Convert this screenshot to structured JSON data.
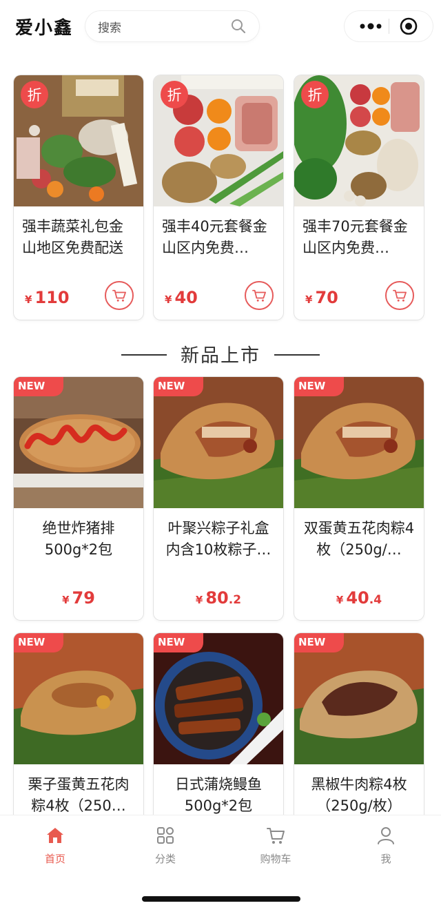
{
  "header": {
    "app_title": "爱小鑫",
    "search_placeholder": "搜索"
  },
  "promo": {
    "badge": "折",
    "products": [
      {
        "name": "强丰蔬菜礼包金山地区免费配送",
        "currency": "¥",
        "price_int": "110",
        "price_dec": ""
      },
      {
        "name": "强丰40元套餐金山区内免费…",
        "currency": "¥",
        "price_int": "40",
        "price_dec": ""
      },
      {
        "name": "强丰70元套餐金山区内免费…",
        "currency": "¥",
        "price_int": "70",
        "price_dec": ""
      }
    ]
  },
  "new_section": {
    "title": "新品上市",
    "badge": "NEW",
    "products": [
      {
        "name": "绝世炸猪排500g*2包",
        "currency": "¥",
        "price_int": "79",
        "price_dec": ""
      },
      {
        "name": "叶聚兴粽子礼盒内含10枚粽子…",
        "currency": "¥",
        "price_int": "80",
        "price_dec": ".2"
      },
      {
        "name": "双蛋黄五花肉粽4枚（250g/…",
        "currency": "¥",
        "price_int": "40",
        "price_dec": ".4"
      },
      {
        "name": "栗子蛋黄五花肉粽4枚（250…",
        "currency": "¥",
        "price_int": "",
        "price_dec": ""
      },
      {
        "name": "日式蒲烧鳗鱼500g*2包",
        "currency": "¥",
        "price_int": "",
        "price_dec": ""
      },
      {
        "name": "黑椒牛肉粽4枚（250g/枚）",
        "currency": "¥",
        "price_int": "",
        "price_dec": ""
      }
    ]
  },
  "tabbar": {
    "tabs": [
      {
        "label": "首页",
        "icon": "home-icon",
        "active": true
      },
      {
        "label": "分类",
        "icon": "category-icon",
        "active": false
      },
      {
        "label": "购物车",
        "icon": "cart-icon",
        "active": false
      },
      {
        "label": "我",
        "icon": "user-icon",
        "active": false
      }
    ]
  },
  "colors": {
    "accent": "#e23b3b",
    "badge": "#ee4b4b",
    "tab_active": "#e85a4f",
    "tab_inactive": "#8a8a8a"
  }
}
